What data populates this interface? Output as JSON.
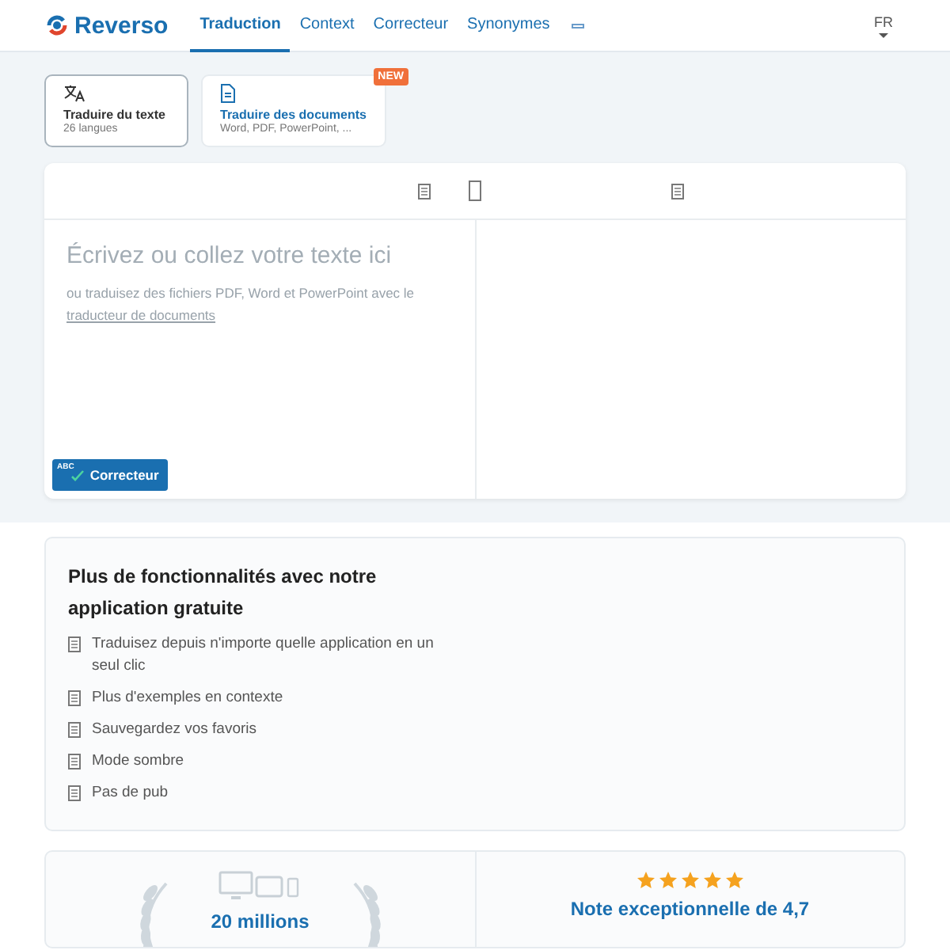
{
  "nav": {
    "logo": "Reverso",
    "links": [
      {
        "label": "Traduction",
        "selected": true
      },
      {
        "label": "Context",
        "selected": false
      },
      {
        "label": "Correcteur",
        "selected": false
      },
      {
        "label": "Synonymes",
        "selected": false
      }
    ],
    "language": "FR"
  },
  "modes": [
    {
      "title": "Traduire du texte",
      "subtitle": "26 langues",
      "selected": true,
      "kind": "text"
    },
    {
      "title": "Traduire des documents",
      "subtitle": "Word, PDF, PowerPoint, ...",
      "selected": false,
      "kind": "document",
      "badge": "NEW"
    }
  ],
  "editor": {
    "placeholder": "Écrivez ou collez votre texte ici",
    "hint": "ou traduisez des fichiers PDF, Word et PowerPoint avec le",
    "hint_link": "traducteur de documents",
    "checker_button": "Correcteur",
    "checker_icon_text": "ABC"
  },
  "features": {
    "title": "Plus de fonctionnalités avec notre application gratuite",
    "items": [
      "Traduisez depuis n'importe quelle application en un seul clic",
      "Plus d'exemples en contexte",
      "Sauvegardez vos favoris",
      "Mode sombre",
      "Pas de pub"
    ]
  },
  "stats": [
    {
      "kind": "downloads",
      "title": "20 millions"
    },
    {
      "kind": "rating",
      "title": "Note exceptionnelle de 4,7",
      "stars": 5
    }
  ]
}
